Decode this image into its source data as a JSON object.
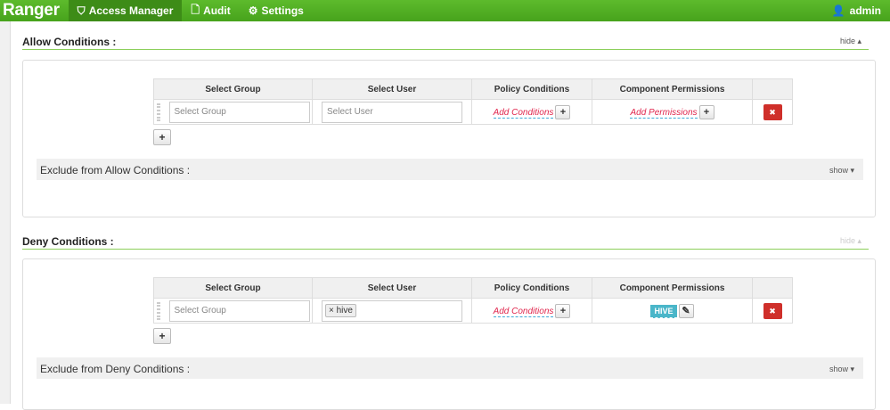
{
  "nav": {
    "brand": "Ranger",
    "items": [
      {
        "label": "Access Manager",
        "icon": "shield-icon"
      },
      {
        "label": "Audit",
        "icon": "file-icon"
      },
      {
        "label": "Settings",
        "icon": "gear-icon"
      }
    ],
    "user": "admin"
  },
  "allow": {
    "title": "Allow Conditions :",
    "toggle": "hide ▴",
    "headers": [
      "Select Group",
      "Select User",
      "Policy Conditions",
      "Component Permissions"
    ],
    "group_placeholder": "Select Group",
    "user_placeholder": "Select User",
    "add_conditions": "Add Conditions",
    "add_permissions": "Add Permissions",
    "exclude": "Exclude from Allow Conditions :",
    "exclude_toggle": "show ▾"
  },
  "deny": {
    "title": "Deny Conditions :",
    "toggle": "hide ▴",
    "headers": [
      "Select Group",
      "Select User",
      "Policy Conditions",
      "Component Permissions"
    ],
    "group_placeholder": "Select Group",
    "user_tag": "hive",
    "add_conditions": "Add Conditions",
    "permission": "HIVE",
    "exclude": "Exclude from Deny Conditions :",
    "exclude_toggle": "show ▾"
  }
}
